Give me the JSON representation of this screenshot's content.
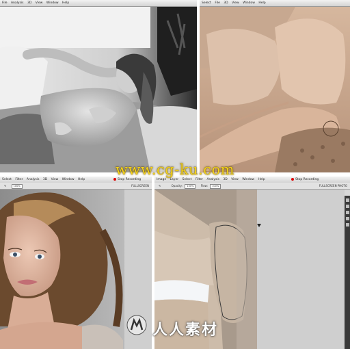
{
  "top_left": {
    "menu": [
      "File",
      "Analysis",
      "3D",
      "View",
      "Window",
      "Help"
    ]
  },
  "top_right": {
    "menu": [
      "Select",
      "File",
      "3D",
      "View",
      "Window",
      "Help"
    ]
  },
  "bottom_left": {
    "menu": [
      "Select",
      "Filter",
      "Analysis",
      "3D",
      "View",
      "Window",
      "Help"
    ],
    "recording": "Stop Recording",
    "fullscreen": "FULLSCREEN",
    "zoom_value": "100%"
  },
  "bottom_right": {
    "menu": [
      "Image",
      "Layer",
      "Select",
      "Filter",
      "Analysis",
      "3D",
      "View",
      "Window",
      "Help"
    ],
    "recording": "Stop Recording",
    "fullscreen": "FULLSCREEN PHOTO",
    "opacity_label": "Opacity:",
    "opacity_value": "100%",
    "flow_label": "Flow:",
    "flow_value": "100%"
  },
  "watermark": "www.cg-ku.com",
  "logo_text": "人人素材",
  "icons": [
    "record-icon",
    "logo-mark-icon",
    "brush-icon"
  ],
  "colors": {
    "watermark": "#f5d21b",
    "menubar": "#e4e4e4",
    "record": "#dd0000"
  }
}
